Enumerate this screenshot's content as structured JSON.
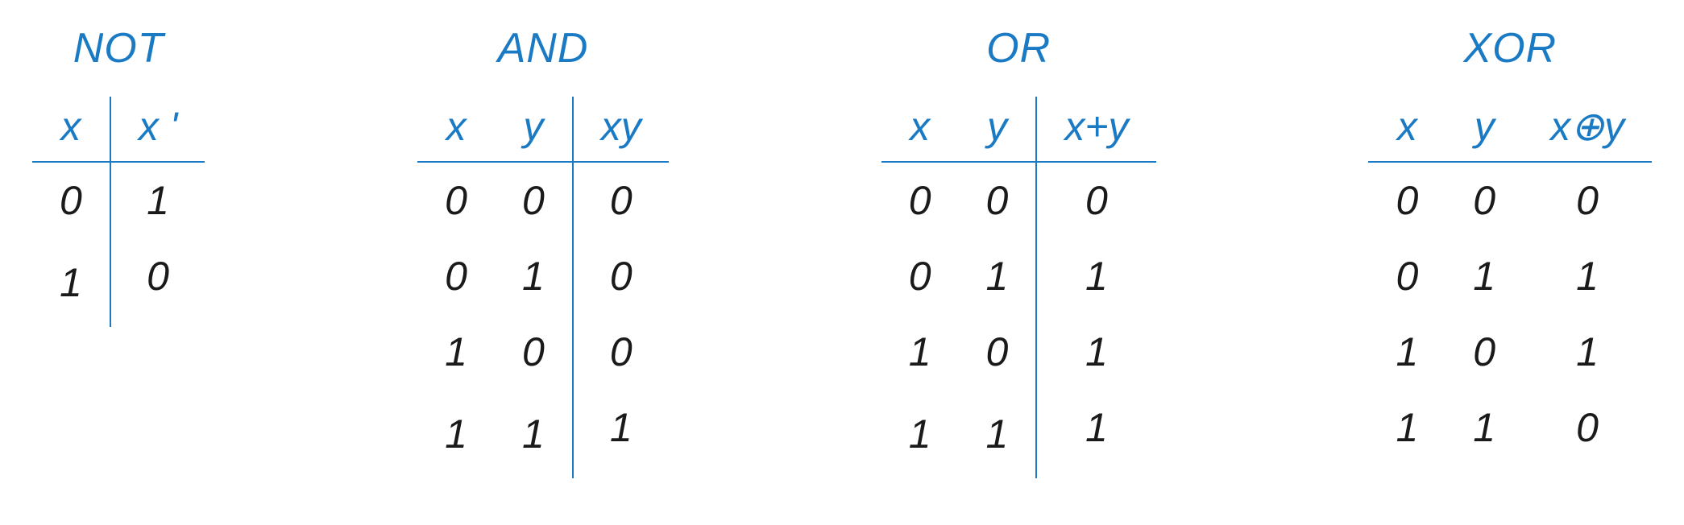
{
  "tables": {
    "not": {
      "title": "NOT",
      "headers": [
        "x",
        "x '"
      ],
      "rows": [
        [
          "0",
          "1"
        ],
        [
          "1",
          "0"
        ]
      ]
    },
    "and": {
      "title": "AND",
      "headers": [
        "x",
        "y",
        "xy"
      ],
      "rows": [
        [
          "0",
          "0",
          "0"
        ],
        [
          "0",
          "1",
          "0"
        ],
        [
          "1",
          "0",
          "0"
        ],
        [
          "1",
          "1",
          "1"
        ]
      ]
    },
    "or": {
      "title": "OR",
      "headers": [
        "x",
        "y",
        "x+y"
      ],
      "rows": [
        [
          "0",
          "0",
          "0"
        ],
        [
          "0",
          "1",
          "1"
        ],
        [
          "1",
          "0",
          "1"
        ],
        [
          "1",
          "1",
          "1"
        ]
      ]
    },
    "xor": {
      "title": "XOR",
      "headers": [
        "x",
        "y",
        "x⊕y"
      ],
      "rows": [
        [
          "0",
          "0",
          "0"
        ],
        [
          "0",
          "1",
          "1"
        ],
        [
          "1",
          "0",
          "1"
        ],
        [
          "1",
          "1",
          "0"
        ]
      ]
    }
  },
  "chart_data": [
    {
      "type": "table",
      "title": "NOT",
      "columns": [
        "x",
        "x'"
      ],
      "rows": [
        [
          0,
          1
        ],
        [
          1,
          0
        ]
      ]
    },
    {
      "type": "table",
      "title": "AND",
      "columns": [
        "x",
        "y",
        "xy"
      ],
      "rows": [
        [
          0,
          0,
          0
        ],
        [
          0,
          1,
          0
        ],
        [
          1,
          0,
          0
        ],
        [
          1,
          1,
          1
        ]
      ]
    },
    {
      "type": "table",
      "title": "OR",
      "columns": [
        "x",
        "y",
        "x+y"
      ],
      "rows": [
        [
          0,
          0,
          0
        ],
        [
          0,
          1,
          1
        ],
        [
          1,
          0,
          1
        ],
        [
          1,
          1,
          1
        ]
      ]
    },
    {
      "type": "table",
      "title": "XOR",
      "columns": [
        "x",
        "y",
        "x⊕y"
      ],
      "rows": [
        [
          0,
          0,
          0
        ],
        [
          0,
          1,
          1
        ],
        [
          1,
          0,
          1
        ],
        [
          1,
          1,
          0
        ]
      ]
    }
  ]
}
